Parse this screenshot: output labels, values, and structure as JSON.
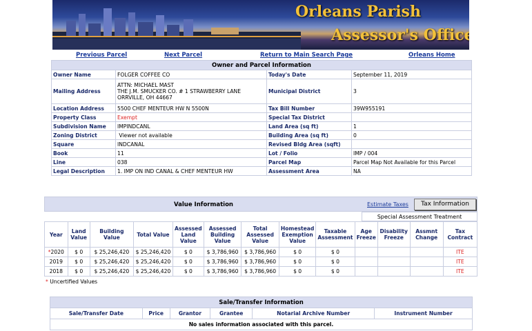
{
  "banner": {
    "line1": "Orleans Parish",
    "line2": "Assessor's Office"
  },
  "nav": {
    "prev": "Previous Parcel",
    "next": "Next Parcel",
    "main": "Return to Main Search Page",
    "home": "Orleans Home"
  },
  "owner": {
    "header": "Owner and Parcel Information",
    "owner_name_label": "Owner Name",
    "owner_name": "FOLGER COFFEE CO",
    "todays_date_label": "Today's Date",
    "todays_date": "September 11, 2019",
    "mailing_label": "Mailing Address",
    "mailing_1": "ATTN: MICHAEL MAST",
    "mailing_2": "THE J.M. SMUCKER CO. # 1 STRAWBERRY LANE",
    "mailing_3": "ORRVILLE, OH 44667",
    "municipal_label": "Municipal District",
    "municipal": "3",
    "location_label": "Location Address",
    "location": "5500 CHEF MENTEUR HW N 5500N",
    "taxbill_label": "Tax Bill Number",
    "taxbill": "39W955191",
    "propclass_label": "Property Class",
    "propclass": "Exempt",
    "special_tax_label": "Special Tax District",
    "special_tax": "",
    "subdivision_label": "Subdivision Name",
    "subdivision": "IMPINDCANL",
    "land_area_label": "Land Area (sq ft)",
    "land_area": "1",
    "zoning_label": "Zoning District",
    "zoning": "Viewer not available",
    "bldg_area_label": "Building Area (sq ft)",
    "bldg_area": "0",
    "square_label": "Square",
    "square": "INDCANAL",
    "rev_bldg_label": "Revised Bldg Area (sqft)",
    "rev_bldg": "",
    "book_label": "Book",
    "book": "11",
    "lot_label": "Lot / Folio",
    "lot": "IMP / 004",
    "line_label": "Line",
    "line": "038",
    "parcel_map_label": "Parcel Map",
    "parcel_map": "Parcel Map Not Available for this Parcel",
    "legal_label": "Legal Description",
    "legal": "1. IMP ON IND CANAL & CHEF MENTEUR HW",
    "assess_area_label": "Assessment Area",
    "assess_area": "NA"
  },
  "value": {
    "title": "Value Information",
    "estimate_link": "Estimate Taxes",
    "tax_button": "Tax Information",
    "special_treatment": "Special Assessment Treatment",
    "columns": [
      "Year",
      "Land Value",
      "Building Value",
      "Total Value",
      "Assessed Land Value",
      "Assessed Building Value",
      "Total Assessed Value",
      "Homestead Exemption Value",
      "Taxable Assessment",
      "Age Freeze",
      "Disability Freeze",
      "Assmnt Change",
      "Tax Contract"
    ],
    "rows": [
      [
        "*2020",
        "$ 0",
        "$ 25,246,420",
        "$ 25,246,420",
        "$ 0",
        "$ 3,786,960",
        "$ 3,786,960",
        "$ 0",
        "$ 0",
        "",
        "",
        "",
        "ITE"
      ],
      [
        "2019",
        "$ 0",
        "$ 25,246,420",
        "$ 25,246,420",
        "$ 0",
        "$ 3,786,960",
        "$ 3,786,960",
        "$ 0",
        "$ 0",
        "",
        "",
        "",
        "ITE"
      ],
      [
        "2018",
        "$ 0",
        "$ 25,246,420",
        "$ 25,246,420",
        "$ 0",
        "$ 3,786,960",
        "$ 3,786,960",
        "$ 0",
        "$ 0",
        "",
        "",
        "",
        "ITE"
      ]
    ],
    "uncertified_star": "*",
    "uncertified": " Uncertified Values"
  },
  "sales": {
    "title": "Sale/Transfer Information",
    "columns": [
      "Sale/Transfer Date",
      "Price",
      "Grantor",
      "Grantee",
      "Notarial Archive Number",
      "Instrument Number"
    ],
    "empty": "No sales information associated with this parcel."
  },
  "colors": {
    "header_bg": "#d9ddf0",
    "link": "#1a3a9a",
    "label": "#1a2a6a",
    "exempt": "#d22",
    "banner_text": "#f3c13a"
  }
}
